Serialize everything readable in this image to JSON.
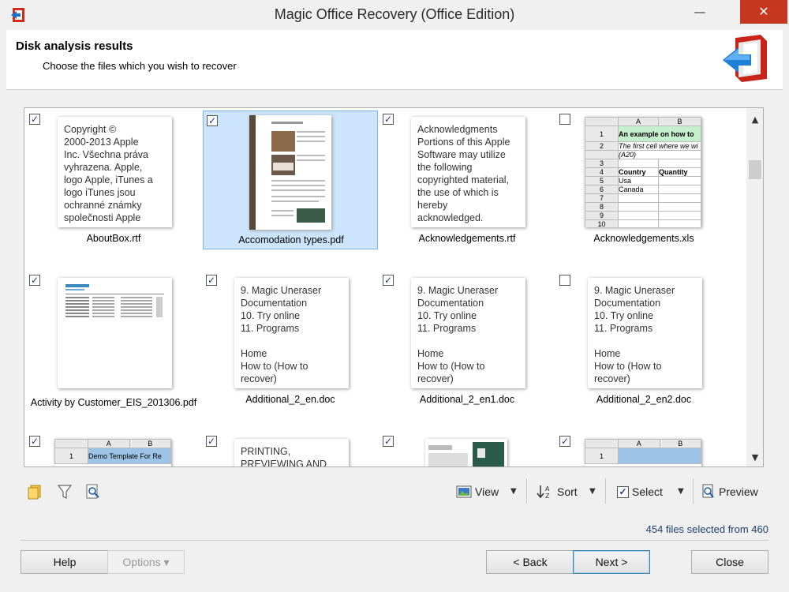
{
  "window": {
    "title": "Magic Office Recovery (Office Edition)",
    "min_glyph": "—",
    "max_glyph": "☐",
    "close_glyph": "✕"
  },
  "header": {
    "title": "Disk analysis results",
    "subtitle": "Choose the files which you wish to recover"
  },
  "files": [
    {
      "name": "AboutBox.rtf",
      "checked": true,
      "selected": false,
      "kind": "text",
      "preview": "Copyright ©\n2000-2013 Apple\nInc. Všechna práva\nvyhrazena. Apple,\nlogo Apple, iTunes a\nlogo iTunes jsou\nochranné známky\nspolečnosti Apple"
    },
    {
      "name": "Accomodation types.pdf",
      "checked": true,
      "selected": true,
      "kind": "pdf-photo",
      "preview": ""
    },
    {
      "name": "Acknowledgements.rtf",
      "checked": true,
      "selected": false,
      "kind": "text",
      "preview": "Acknowledgments\nPortions of this Apple\nSoftware may utilize\nthe following\ncopyrighted material,\nthe use of which is\nhereby\nacknowledged."
    },
    {
      "name": "Acknowledgements.xls",
      "checked": false,
      "selected": false,
      "kind": "sheet",
      "preview": ""
    },
    {
      "name": "Activity by Customer_EIS_201306.pdf",
      "checked": true,
      "selected": false,
      "kind": "pdf-report",
      "preview": ""
    },
    {
      "name": "Additional_2_en.doc",
      "checked": true,
      "selected": false,
      "kind": "text",
      "preview": "9. Magic Uneraser\nDocumentation\n10. Try online\n11. Programs\n\nHome\nHow to (How to\nrecover)"
    },
    {
      "name": "Additional_2_en1.doc",
      "checked": true,
      "selected": false,
      "kind": "text",
      "preview": "9. Magic Uneraser\nDocumentation\n10. Try online\n11. Programs\n\nHome\nHow to (How to\nrecover)"
    },
    {
      "name": "Additional_2_en2.doc",
      "checked": false,
      "selected": false,
      "kind": "text",
      "preview": "9. Magic Uneraser\nDocumentation\n10. Try online\n11. Programs\n\nHome\nHow to (How to\nrecover)"
    },
    {
      "name": "",
      "checked": true,
      "selected": false,
      "kind": "sheet2",
      "preview": ""
    },
    {
      "name": "",
      "checked": true,
      "selected": false,
      "kind": "text",
      "preview": "PRINTING,\nPREVIEWING AND"
    },
    {
      "name": "",
      "checked": true,
      "selected": false,
      "kind": "pdf-brochure",
      "preview": ""
    },
    {
      "name": "",
      "checked": true,
      "selected": false,
      "kind": "sheet3",
      "preview": ""
    }
  ],
  "sheet_preview": {
    "cols": [
      "A",
      "B"
    ],
    "rows": [
      "1",
      "2",
      "3",
      "4",
      "5",
      "6",
      "7",
      "8",
      "9",
      "10"
    ],
    "title_cell": "An example on how to",
    "note_cell": "The first cell where we wi",
    "note_cell2": "(A20)",
    "header_country": "Country",
    "header_quantity": "Quantity",
    "val_usa": "Usa",
    "val_canada": "Canada"
  },
  "sheet2_preview": {
    "cols": [
      "A",
      "B"
    ],
    "row1": "1",
    "title_cell": "Demo Template For Re"
  },
  "sheet3_preview": {
    "cols": [
      "A",
      "B"
    ],
    "row1": "1"
  },
  "toolbar": {
    "view_label": "View",
    "sort_label": "Sort",
    "select_label": "Select",
    "preview_label": "Preview",
    "dropdown_glyph": "▼"
  },
  "status": {
    "text": "454 files selected from 460"
  },
  "buttons": {
    "help": "Help",
    "options": "Options ▾",
    "back": "< Back",
    "next": "Next >",
    "close": "Close"
  },
  "colors": {
    "accent_red": "#c7361f",
    "selection_bg": "#cce4fc",
    "sheet_green": "#c6efce",
    "sheet_blue": "#9dc3e6"
  }
}
